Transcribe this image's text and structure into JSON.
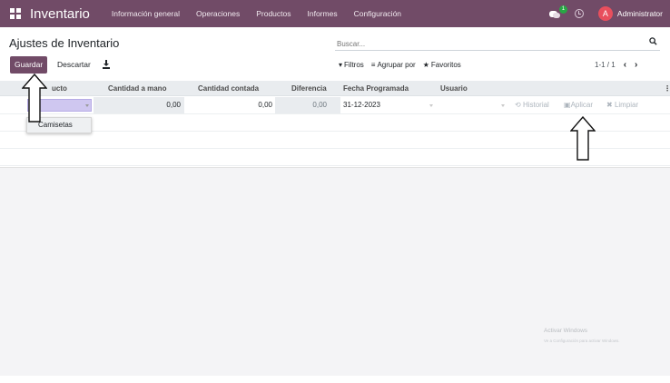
{
  "app": {
    "title": "Inventario"
  },
  "menu": [
    "Información general",
    "Operaciones",
    "Productos",
    "Informes",
    "Configuración"
  ],
  "user": {
    "name": "Administrator",
    "initial": "A",
    "notifications": "1"
  },
  "page": {
    "title": "Ajustes de Inventario"
  },
  "toolbar": {
    "save_label": "Guardar",
    "discard_label": "Descartar"
  },
  "search": {
    "placeholder": "Buscar..."
  },
  "filters": {
    "filters_label": "Filtros",
    "group_label": "Agrupar por",
    "favorites_label": "Favoritos"
  },
  "pager": {
    "text": "1-1 / 1"
  },
  "table": {
    "headers": [
      "Producto",
      "Cantidad a mano",
      "Cantidad contada",
      "Diferencia",
      "Fecha Programada",
      "Usuario"
    ],
    "header_product_visible": "ucto",
    "row": {
      "on_hand": "0,00",
      "counted": "0,00",
      "difference": "0,00",
      "date": "31-12-2023"
    },
    "actions": {
      "history": "Historial",
      "apply": "Aplicar",
      "clear": "Limpiar"
    }
  },
  "dropdown": {
    "option": "Camisetas"
  },
  "watermark": {
    "title": "Activar Windows",
    "subtitle": "Ve a Configuración para activar Windows."
  },
  "colors": {
    "brand": "#714b67",
    "avatar": "#e84f5d",
    "selection": "#cfc7f0"
  }
}
